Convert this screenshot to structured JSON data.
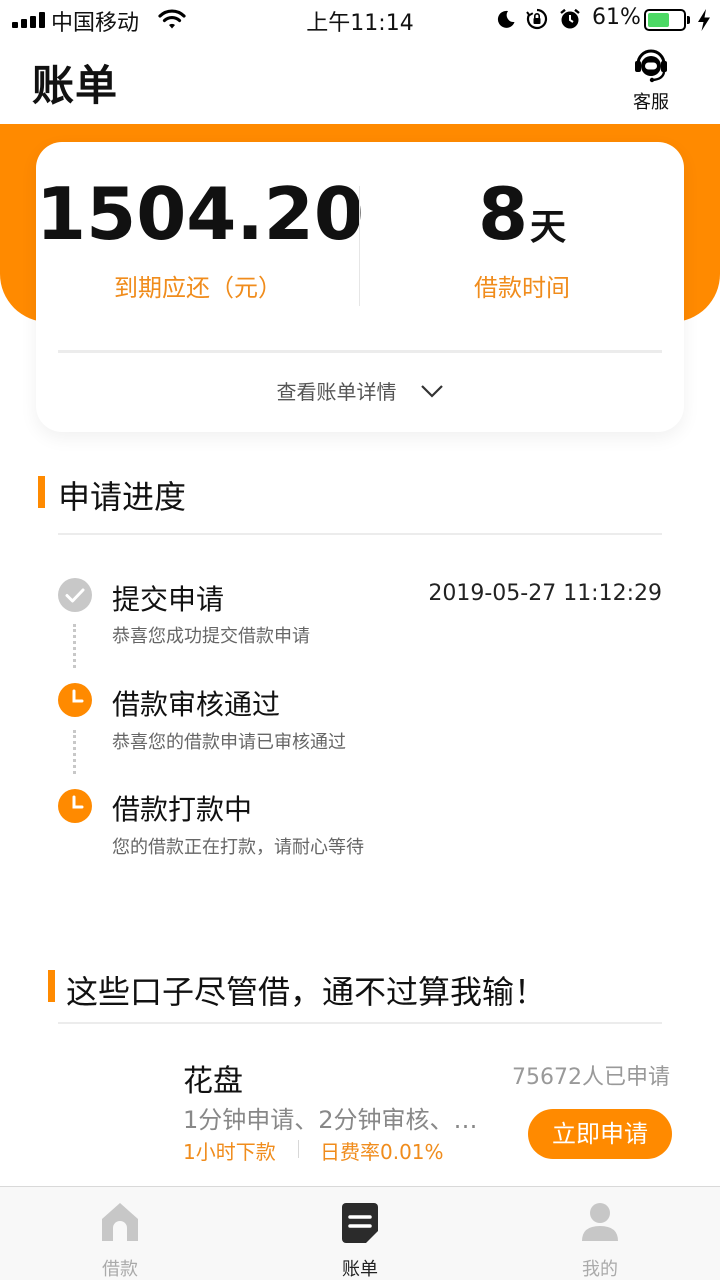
{
  "status_bar": {
    "carrier": "中国移动",
    "time": "上午11:14",
    "battery_percent": "61%",
    "battery_level": 0.61,
    "battery_color": "#4cd964"
  },
  "header": {
    "title": "账单",
    "service_label": "客服",
    "service_icon": "headset-icon"
  },
  "bill_card": {
    "amount": "1504.20",
    "amount_label": "到期应还（元）",
    "days": "8",
    "days_unit": "天",
    "days_label": "借款时间",
    "details_link": "查看账单详情",
    "details_icon": "chevron-down-icon"
  },
  "progress": {
    "title": "申请进度",
    "steps": [
      {
        "title": "提交申请",
        "subtitle": "恭喜您成功提交借款申请",
        "time": "2019-05-27 11:12:29",
        "status": "done",
        "icon": "check-circle-icon"
      },
      {
        "title": "借款审核通过",
        "subtitle": "恭喜您的借款申请已审核通过",
        "status": "pending",
        "icon": "clock-icon"
      },
      {
        "title": "借款打款中",
        "subtitle": "您的借款正在打款，请耐心等待",
        "status": "pending",
        "icon": "clock-icon"
      }
    ]
  },
  "recommend": {
    "title": "这些口子尽管借，通不过算我输！",
    "product": {
      "name": "花盘",
      "applicants": "75672人已申请",
      "description": "1分钟申请、2分钟审核、…",
      "tag_speed": "1小时下款",
      "tag_rate": "日费率0.01%",
      "apply_label": "立即申请"
    }
  },
  "tab_bar": {
    "tabs": [
      {
        "label": "借款",
        "icon": "house-icon",
        "active": false
      },
      {
        "label": "账单",
        "icon": "bill-icon",
        "active": true
      },
      {
        "label": "我的",
        "icon": "person-icon",
        "active": false
      }
    ]
  },
  "colors": {
    "accent": "#ff8a00",
    "accent_text": "#f08c1c",
    "tab_inactive": "#aaaaaa",
    "tab_active": "#222222"
  }
}
